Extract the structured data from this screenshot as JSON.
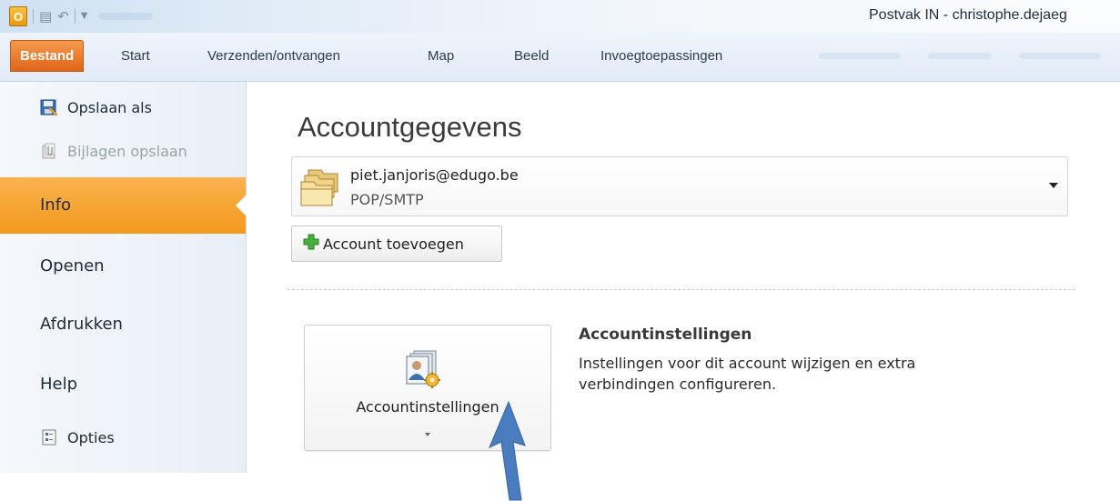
{
  "titlebar": {
    "app_logo": "O",
    "window_title": "Postvak IN - christophe.dejaeg"
  },
  "ribbon": {
    "file_tab": "Bestand",
    "tabs": [
      "Start",
      "Verzenden/ontvangen",
      "Map",
      "Beeld",
      "Invoegtoepassingen"
    ]
  },
  "leftnav": {
    "save_as": "Opslaan als",
    "save_attachments": "Bijlagen opslaan",
    "info": "Info",
    "open": "Openen",
    "print": "Afdrukken",
    "help": "Help",
    "options": "Opties"
  },
  "main": {
    "title": "Accountgegevens",
    "account": {
      "email": "piet.janjoris@edugo.be",
      "type": "POP/SMTP"
    },
    "add_account_label": "Account toevoegen",
    "settings_button_label": "Accountinstellingen",
    "settings_heading": "Accountinstellingen",
    "settings_description": "Instellingen voor dit account wijzigen en extra verbindingen configureren."
  },
  "colors": {
    "file_tab": "#e0641a",
    "active_nav": "#f29a1d",
    "annotation_arrow": "#4a7dbf"
  },
  "icons": {
    "save_as": "save-as-icon",
    "save_attachments": "attachments-icon",
    "options": "options-icon",
    "account": "account-folders-icon",
    "add": "green-plus-icon",
    "settings": "account-settings-icon"
  }
}
